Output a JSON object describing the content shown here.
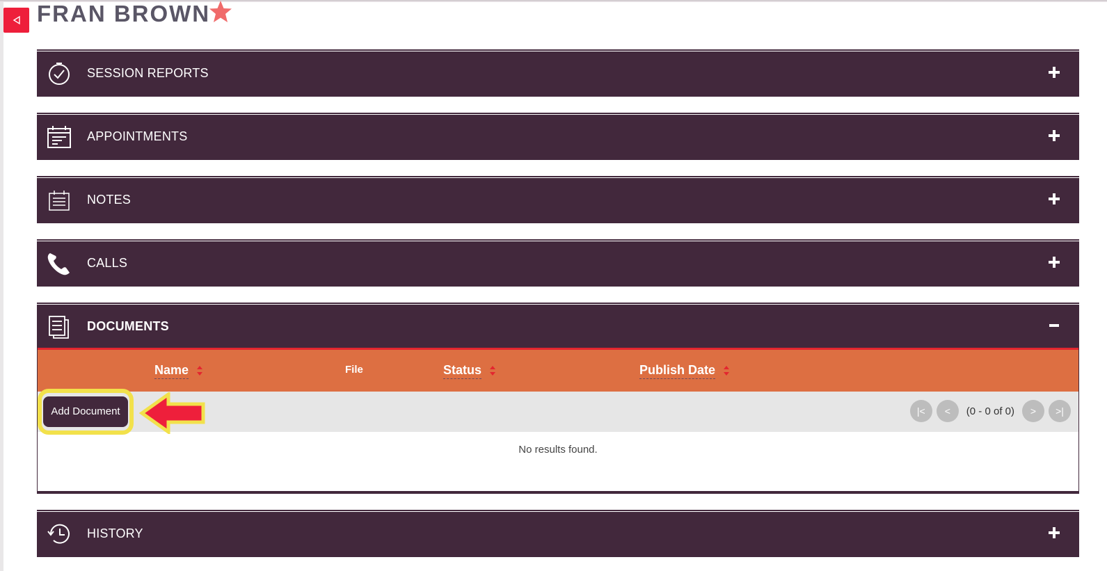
{
  "page": {
    "title": "FRAN BROWN",
    "back_icon": "back-triangle-icon",
    "favorite_icon": "star-icon"
  },
  "colors": {
    "panel_bg": "#42283c",
    "header_orange": "#dd6f42",
    "accent_red": "#ee1f3b",
    "highlight_yellow": "#f2e14b"
  },
  "panels": [
    {
      "title": "SESSION REPORTS",
      "icon": "clock-check-icon",
      "toggle": "+"
    },
    {
      "title": "APPOINTMENTS",
      "icon": "calendar-icon",
      "toggle": "+"
    },
    {
      "title": "NOTES",
      "icon": "notepad-icon",
      "toggle": "+"
    },
    {
      "title": "CALLS",
      "icon": "phone-icon",
      "toggle": "+"
    },
    {
      "title": "DOCUMENTS",
      "icon": "documents-icon",
      "toggle": "−"
    },
    {
      "title": "HISTORY",
      "icon": "history-icon",
      "toggle": "+"
    }
  ],
  "documents": {
    "columns": [
      "Name",
      "File",
      "Status",
      "Publish Date"
    ],
    "add_button": "Add Document",
    "pager": {
      "first": "|<",
      "prev": "<",
      "info": "(0 - 0 of 0)",
      "next": ">",
      "last": ">|"
    },
    "empty_text": "No results found."
  }
}
